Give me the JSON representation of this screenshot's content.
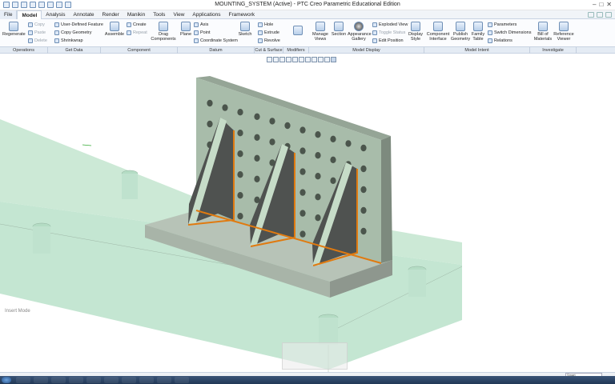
{
  "window_title": "MOUNTING_SYSTEM (Active) - PTC Creo Parametric Educational Edition",
  "menus": [
    "File",
    "Model",
    "Analysis",
    "Annotate",
    "Render",
    "Manikin",
    "Tools",
    "View",
    "Applications",
    "Framework"
  ],
  "active_menu": "Model",
  "ribbon": {
    "regenerate": "Regenerate",
    "copy": "Copy",
    "paste": "Paste",
    "delete": "Delete",
    "user_defined_feature": "User-Defined Feature",
    "copy_geometry": "Copy Geometry",
    "shrinkwrap": "Shrinkwrap",
    "assemble": "Assemble",
    "create": "Create",
    "repeat": "Repeat",
    "drag_components": "Drag Components",
    "plane": "Plane",
    "axis": "Axis",
    "point": "Point",
    "coordinate_system": "Coordinate System",
    "sketch": "Sketch",
    "hole": "Hole",
    "extrude": "Extrude",
    "revolve": "Revolve",
    "manage_views": "Manage Views",
    "section": "Section",
    "appearance_gallery": "Appearance Gallery",
    "exploded_view": "Exploded View",
    "toggle_status": "Toggle Status",
    "edit_position": "Edit Position",
    "display_style": "Display Style",
    "component_interface": "Component Interface",
    "publish_geometry": "Publish Geometry",
    "family_table": "Family Table",
    "parameters": "Parameters",
    "switch_dimensions": "Switch Dimensions",
    "relations": "Relations",
    "bill_of_materials": "Bill of Materials",
    "reference_viewer": "Reference Viewer"
  },
  "groups": [
    "Operations",
    "Get Data",
    "Component",
    "Datum",
    "Cut & Surface",
    "Modifiers",
    "Model Display",
    "Model Intent",
    "Investigate"
  ],
  "mode_text": "Insert Mode",
  "status_select": "Smart",
  "colors": {
    "base": "#c9e6d2",
    "plate": "#a8bcaa",
    "weld": "#e07a10",
    "rib_dark": "#555555"
  }
}
